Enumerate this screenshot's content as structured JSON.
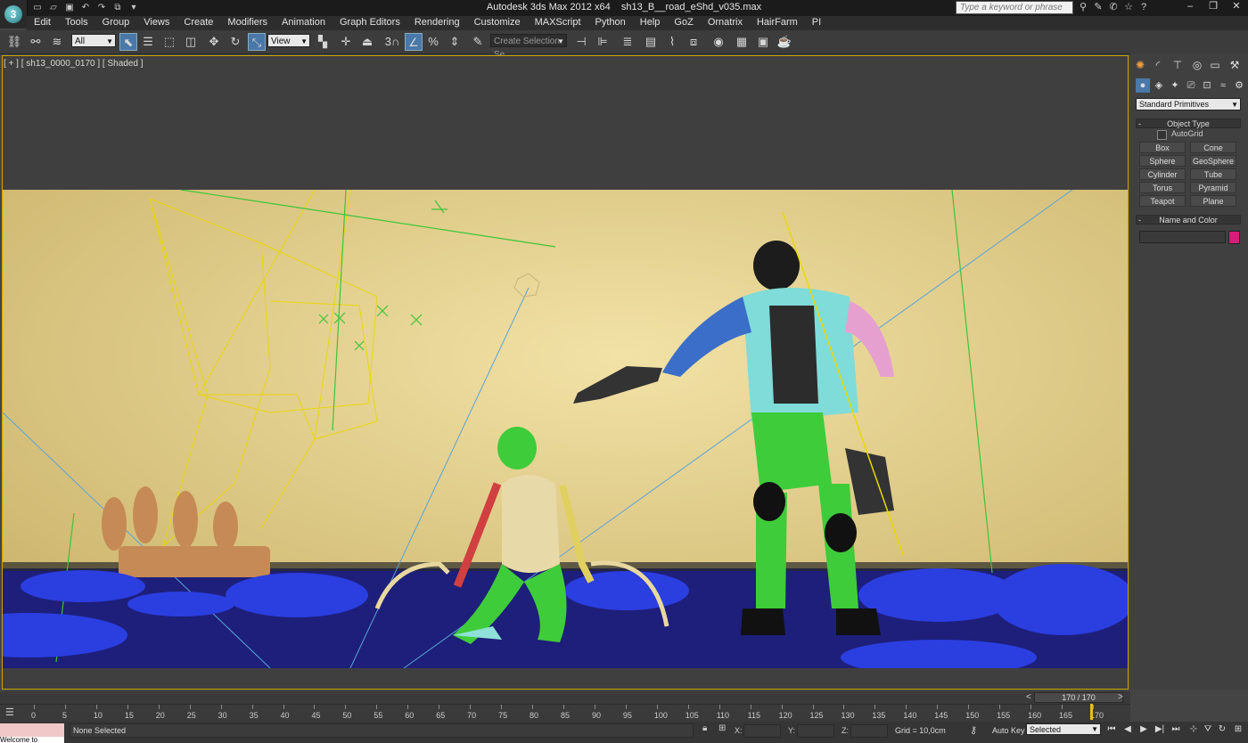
{
  "window": {
    "title_app": "Autodesk 3ds Max  2012 x64",
    "title_file": "sh13_B__road_eShd_v035.max",
    "search_placeholder": "Type a keyword or phrase",
    "logo_letter": "3"
  },
  "menu": [
    "Edit",
    "Tools",
    "Group",
    "Views",
    "Create",
    "Modifiers",
    "Animation",
    "Graph Editors",
    "Rendering",
    "Customize",
    "MAXScript",
    "Python",
    "Help",
    "GoZ",
    "Ornatrix",
    "HairFarm",
    "PI"
  ],
  "toolbar": {
    "selection_filter": "All",
    "ref_coord": "View",
    "named_selection_placeholder": "Create Selection Se",
    "snap_label": "3",
    "percent_snap": "%"
  },
  "viewport": {
    "label": "[ + ] [ sh13_0000_0170 ] [ Shaded ]"
  },
  "command_panel": {
    "category": "Standard Primitives",
    "object_type_title": "Object Type",
    "autogrid_label": "AutoGrid",
    "primitives": [
      "Box",
      "Cone",
      "Sphere",
      "GeoSphere",
      "Cylinder",
      "Tube",
      "Torus",
      "Pyramid",
      "Teapot",
      "Plane"
    ],
    "name_and_color_title": "Name and Color",
    "object_color": "#d21e7a"
  },
  "timeline": {
    "frame_display": "170 / 170",
    "current_frame": 170,
    "ticks": [
      "0",
      "5",
      "10",
      "15",
      "20",
      "25",
      "30",
      "35",
      "40",
      "45",
      "50",
      "55",
      "60",
      "65",
      "70",
      "75",
      "80",
      "85",
      "90",
      "95",
      "100",
      "105",
      "110",
      "115",
      "120",
      "125",
      "130",
      "135",
      "140",
      "145",
      "150",
      "155",
      "160",
      "165",
      "170"
    ]
  },
  "status": {
    "maxscript_text": "Welcome to MAXScript",
    "selection": "None Selected",
    "x_label": "X:",
    "y_label": "Y:",
    "z_label": "Z:",
    "grid": "Grid = 10,0cm",
    "auto_key": "Auto Key",
    "key_mode": "Selected"
  },
  "colors": {
    "viewport_border": "#c8a600",
    "floor": "#1d1f7a",
    "backdrop": "#e4cf8a"
  }
}
